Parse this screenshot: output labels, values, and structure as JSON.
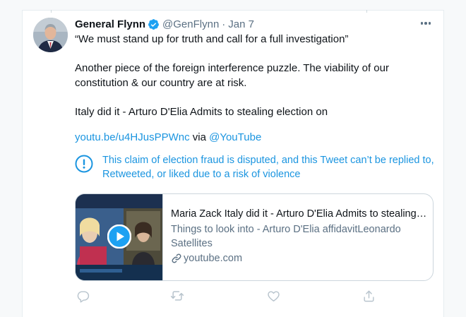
{
  "tweet": {
    "author_name": "General Flynn",
    "handle": "@GenFlynn",
    "separator": "·",
    "date": "Jan 7",
    "text_lines": [
      "“We must stand up for truth and call for a full investigation”",
      "Another piece of the foreign interference puzzle. The viability of our",
      "constitution & our country are at risk.",
      "Italy did it -  Arturo D'Elia  Admits to stealing election on"
    ],
    "link_url": "youtu.be/u4HJusPPWnc",
    "link_via": " via ",
    "link_mention": "@YouTube",
    "notice_text": "This claim of election fraud is disputed, and this Tweet can’t be replied to, Retweeted, or liked due to a risk of violence",
    "card": {
      "title": "Maria Zack Italy did it - Arturo D'Elia Admits to stealing election on",
      "description": "Things to look into - Arturo D'Elia affidavitLeonardo Satellites",
      "domain": "youtube.com"
    }
  },
  "icons": {
    "verified": "verified-badge-icon",
    "more": "more-options-icon",
    "notice": "info-icon",
    "play": "play-icon",
    "domain": "link-icon",
    "reply": "reply-icon",
    "retweet": "retweet-icon",
    "like": "like-icon",
    "share": "share-icon"
  },
  "colors": {
    "accent": "#1b95e0",
    "text": "#0f1419",
    "secondary": "#5b7083",
    "border": "#ccd6dd"
  }
}
